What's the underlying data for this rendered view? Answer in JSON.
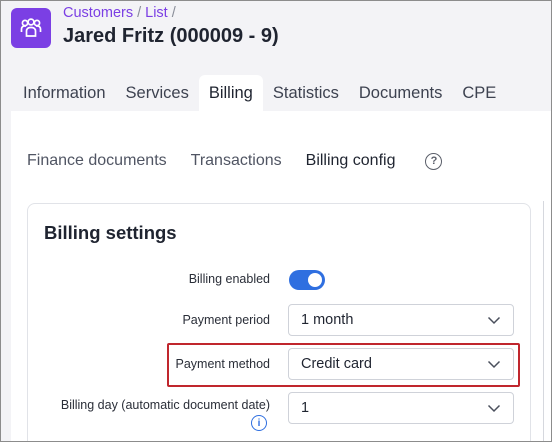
{
  "breadcrumb": {
    "items": [
      "Customers",
      "List"
    ],
    "separator": "/"
  },
  "page": {
    "title": "Jared Fritz (000009 - 9)"
  },
  "tabs": [
    {
      "label": "Information",
      "active": false
    },
    {
      "label": "Services",
      "active": false
    },
    {
      "label": "Billing",
      "active": true
    },
    {
      "label": "Statistics",
      "active": false
    },
    {
      "label": "Documents",
      "active": false
    },
    {
      "label": "CPE",
      "active": false
    }
  ],
  "subtabs": [
    {
      "label": "Finance documents",
      "active": false
    },
    {
      "label": "Transactions",
      "active": false
    },
    {
      "label": "Billing config",
      "active": true
    }
  ],
  "help_icon": {
    "glyph": "?"
  },
  "billing_settings": {
    "title": "Billing settings",
    "billing_enabled": {
      "label": "Billing enabled",
      "value": true
    },
    "payment_period": {
      "label": "Payment period",
      "value": "1 month"
    },
    "payment_method": {
      "label": "Payment method",
      "value": "Credit card"
    },
    "billing_day": {
      "label": "Billing day (automatic document date)",
      "value": "1",
      "info_glyph": "i"
    }
  },
  "colors": {
    "accent": "#7b3fe4",
    "toggle_on": "#2f6fe0",
    "highlight": "#c0262d"
  }
}
